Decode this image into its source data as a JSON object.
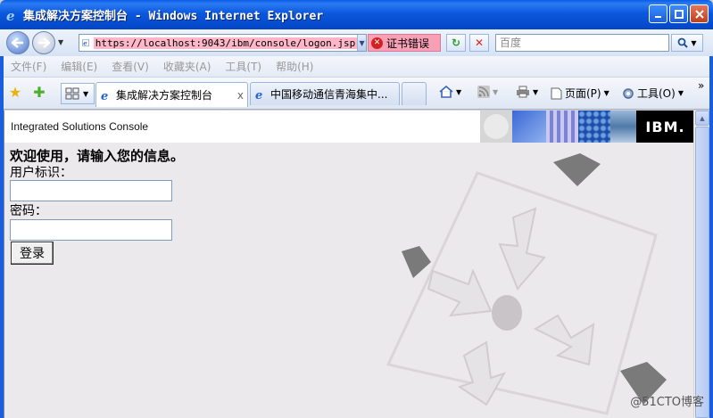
{
  "window": {
    "title": "集成解决方案控制台 - Windows Internet Explorer"
  },
  "address_bar": {
    "url": "https://localhost:9043/ibm/console/logon.jsp",
    "cert_error": "证书错误",
    "search_placeholder": "百度"
  },
  "menu": {
    "items": [
      "文件(F)",
      "编辑(E)",
      "查看(V)",
      "收藏夹(A)",
      "工具(T)",
      "帮助(H)"
    ]
  },
  "tabs": [
    {
      "label": "集成解决方案控制台",
      "active": true
    },
    {
      "label": "中国移动通信青海集中...",
      "active": false
    }
  ],
  "command_bar": {
    "page_label": "页面(P)",
    "tools_label": "工具(O)",
    "more": "»"
  },
  "page": {
    "banner_title": "Integrated Solutions Console",
    "brand": "IBM.",
    "welcome": "欢迎使用，请输入您的信息。",
    "user_id_label": "用户标识：",
    "password_label": "密码：",
    "user_id_value": "",
    "password_value": "",
    "login_button": "登录"
  },
  "watermark": "@51CTO博客",
  "colors": {
    "titlebar": "#0b58dd",
    "cert_error_bg": "#f8a0b5",
    "content_bg": "#ece9ec"
  }
}
